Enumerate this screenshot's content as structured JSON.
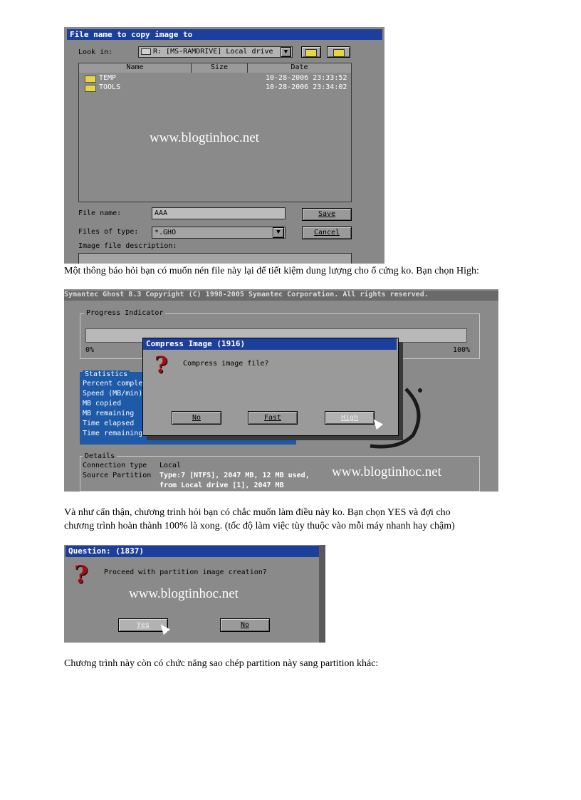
{
  "screenshot1": {
    "title": "File name to copy image to",
    "look_in_label": "Look in:",
    "look_in_value": "R: [MS-RAMDRIVE] Local drive",
    "columns": [
      "Name",
      "Size",
      "Date"
    ],
    "files": [
      {
        "name": "TEMP",
        "date": "10-28-2006 23:33:52"
      },
      {
        "name": "TOOLS",
        "date": "10-28-2006 23:34:02"
      }
    ],
    "watermark": "www.blogtinhoc.net",
    "file_name_label": "File name:",
    "file_name_value": "AAA",
    "files_of_type_label": "Files of type:",
    "files_of_type_value": "*.GHO",
    "save_button": "Save",
    "cancel_button": "Cancel",
    "description_label": "Image file description:"
  },
  "paragraph1": "Một thông báo hỏi bạn có muốn nén file này lại để tiết kiệm dung lượng cho ổ cứng ko. Bạn chọn High:",
  "screenshot2": {
    "header": "Symantec Ghost 8.3   Copyright (C) 1998-2005 Symantec Corporation. All rights reserved.",
    "progress_label": "Progress Indicator",
    "pct_start": "0%",
    "pct_end": "100%",
    "statistics_label": "Statistics",
    "stats": [
      "Percent complete",
      "Speed (MB/min)",
      "MB copied",
      "MB remaining",
      "Time elapsed",
      "Time remaining"
    ],
    "dialog_title": "Compress Image (1916)",
    "dialog_question": "Compress image file?",
    "btn_no": "No",
    "btn_fast": "Fast",
    "btn_high": "High",
    "details_label": "Details",
    "connection_type_label": "Connection type",
    "connection_type_value": "Local",
    "source_partition_label": "Source Partition",
    "source_partition_line1": "Type:7 [NTFS], 2047 MB, 12 MB used,",
    "source_partition_line2": "from Local drive [1], 2047 MB",
    "watermark": "www.blogtinhoc.net"
  },
  "paragraph2_line1": "Và như cẩn thận, chương trình hỏi bạn có chắc muốn làm điều này ko. Bạn chọn YES và đợi cho",
  "paragraph2_line2": "chương trình hoàn thành 100% là xong. (tốc độ làm việc tùy thuộc vào mỗi máy nhanh hay chậm)",
  "screenshot3": {
    "title": "Question: (1837)",
    "question": "Proceed with partition image creation?",
    "watermark": "www.blogtinhoc.net",
    "btn_yes": "Yes",
    "btn_no": "No"
  },
  "paragraph3": "Chương trình này còn có chức năng sao chép partition này sang partition khác:",
  "colors": {
    "titlebar": "#1c3f9c",
    "window_gray": "#8c8c8c",
    "stats_blue": "#1f5aa8",
    "question_mark": "#a10d10"
  }
}
